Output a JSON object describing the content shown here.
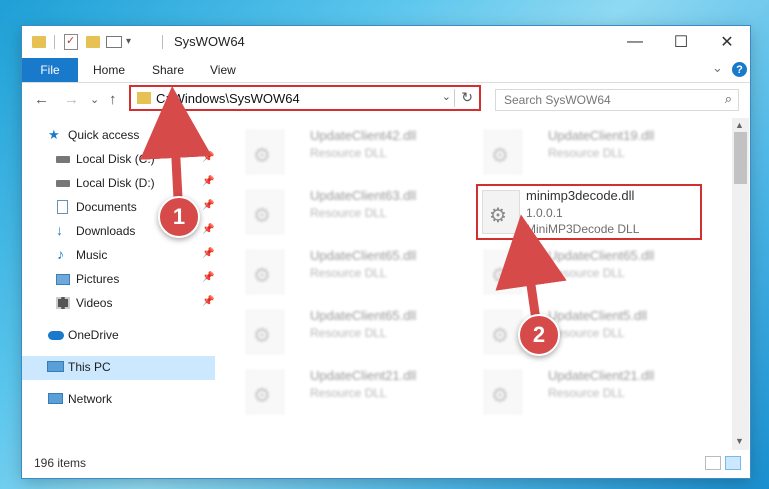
{
  "window": {
    "title": "SysWOW64",
    "controls": {
      "minimize": "—",
      "maximize": "☐",
      "close": "✕"
    }
  },
  "ribbon": {
    "tabs": [
      "File",
      "Home",
      "Share",
      "View"
    ],
    "collapse": "⌄",
    "help": "?"
  },
  "nav": {
    "back": "←",
    "forward": "→",
    "recent": "⌄",
    "up": "↑"
  },
  "address": {
    "path": "C:\\Windows\\SysWOW64",
    "dropdown": "⌄",
    "refresh": "↻"
  },
  "search": {
    "placeholder": "Search SysWOW64",
    "icon": "⌕"
  },
  "sidebar": {
    "quick_access": "Quick access",
    "items": [
      {
        "label": "Local Disk (C:)",
        "icon": "drive-icon",
        "pinned": true
      },
      {
        "label": "Local Disk (D:)",
        "icon": "drive-icon",
        "pinned": true
      },
      {
        "label": "Documents",
        "icon": "documents-icon",
        "pinned": true
      },
      {
        "label": "Downloads",
        "icon": "downloads-icon",
        "pinned": true
      },
      {
        "label": "Music",
        "icon": "music-icon",
        "pinned": true
      },
      {
        "label": "Pictures",
        "icon": "pictures-icon",
        "pinned": true
      },
      {
        "label": "Videos",
        "icon": "videos-icon",
        "pinned": true
      }
    ],
    "onedrive": "OneDrive",
    "this_pc": "This PC",
    "network": "Network"
  },
  "files": [
    {
      "name": "UpdateClient42.dll",
      "desc": "Resource DLL"
    },
    {
      "name": "UpdateClient19.dll",
      "desc": "Resource DLL"
    },
    {
      "name": "UpdateClient63.dll",
      "desc": "Resource DLL"
    },
    {
      "name": "minimp3decode.dll",
      "version": "1.0.0.1",
      "desc": "MiniMP3Decode DLL"
    },
    {
      "name": "UpdateClient65.dll",
      "desc": "Resource DLL"
    },
    {
      "name": "UpdateClient65.dll",
      "desc": "Resource DLL"
    },
    {
      "name": "UpdateClient65.dll",
      "desc": "Resource DLL"
    },
    {
      "name": "UpdateClient5.dll",
      "desc": "Resource DLL"
    },
    {
      "name": "UpdateClient21.dll",
      "desc": "Resource DLL"
    },
    {
      "name": "UpdateClient21.dll",
      "desc": "Resource DLL"
    }
  ],
  "status": {
    "items": "196 items"
  },
  "annotations": {
    "step1": "1",
    "step2": "2"
  },
  "colors": {
    "accent": "#1979ca",
    "highlight": "#d32f2f",
    "callout": "#d64a4a",
    "selected": "#cce8ff"
  }
}
